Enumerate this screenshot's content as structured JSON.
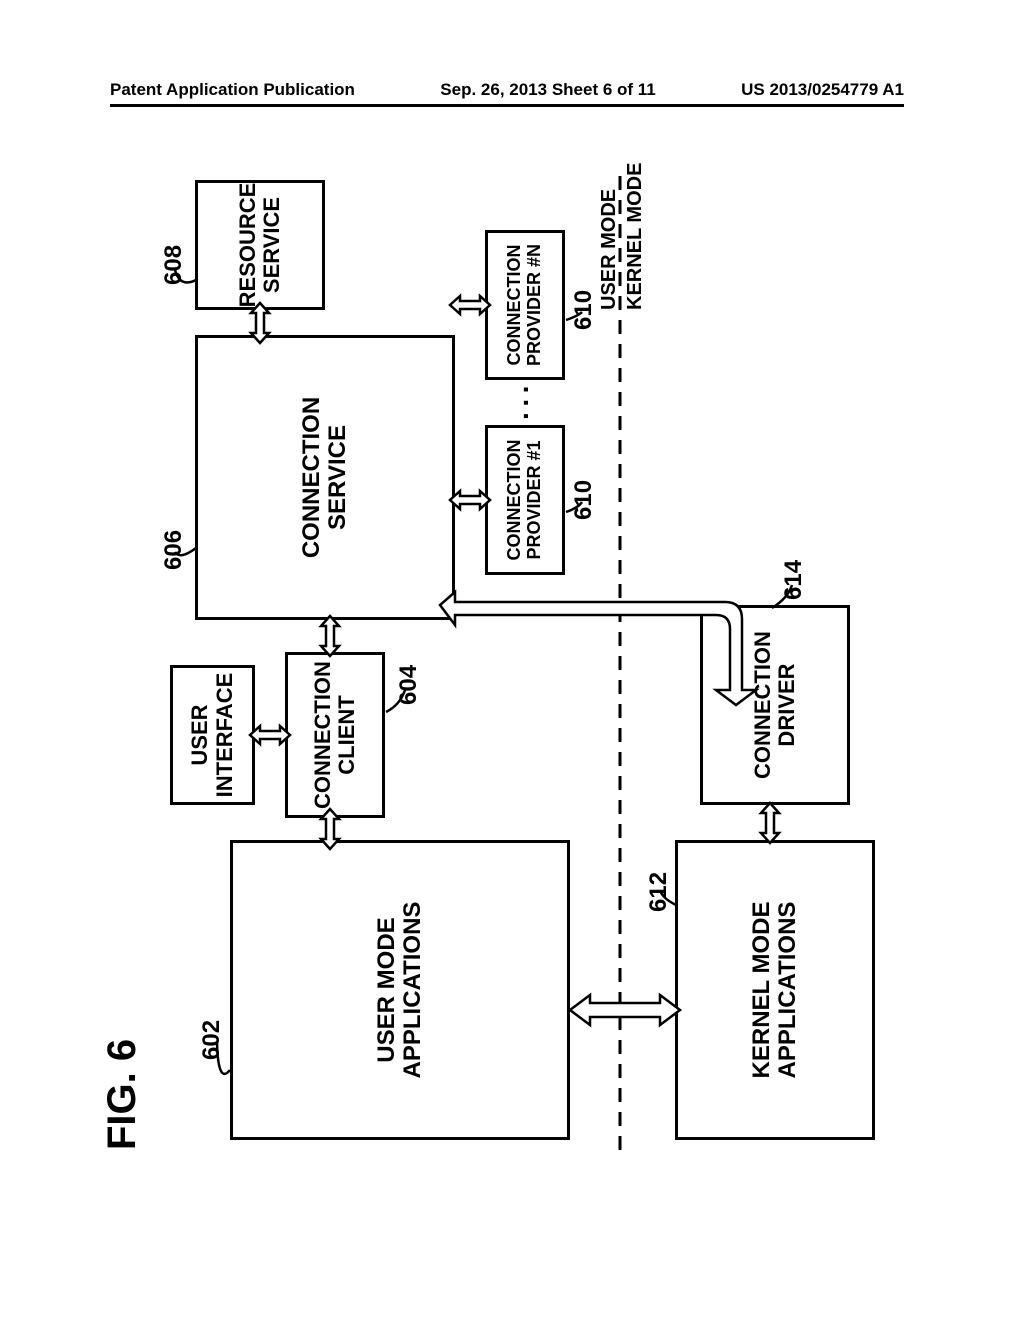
{
  "header": {
    "left": "Patent Application Publication",
    "center": "Sep. 26, 2013  Sheet 6 of 11",
    "right": "US 2013/0254779 A1"
  },
  "figure_label": "FIG. 6",
  "boxes": {
    "user_mode_apps": "USER MODE APPLICATIONS",
    "user_interface": "USER INTERFACE",
    "connection_client": "CONNECTION CLIENT",
    "connection_service": "CONNECTION SERVICE",
    "resource_service": "RESOURCE SERVICE",
    "connection_provider_1": "CONNECTION PROVIDER #1",
    "connection_provider_n": "CONNECTION PROVIDER #N",
    "kernel_mode_apps": "KERNEL MODE APPLICATIONS",
    "connection_driver": "CONNECTION DRIVER"
  },
  "mode_labels": {
    "user": "USER MODE",
    "kernel": "KERNEL MODE"
  },
  "refs": {
    "602": "602",
    "604": "604",
    "606": "606",
    "608": "608",
    "610a": "610",
    "610b": "610",
    "612": "612",
    "614": "614"
  },
  "ellipsis": "···"
}
